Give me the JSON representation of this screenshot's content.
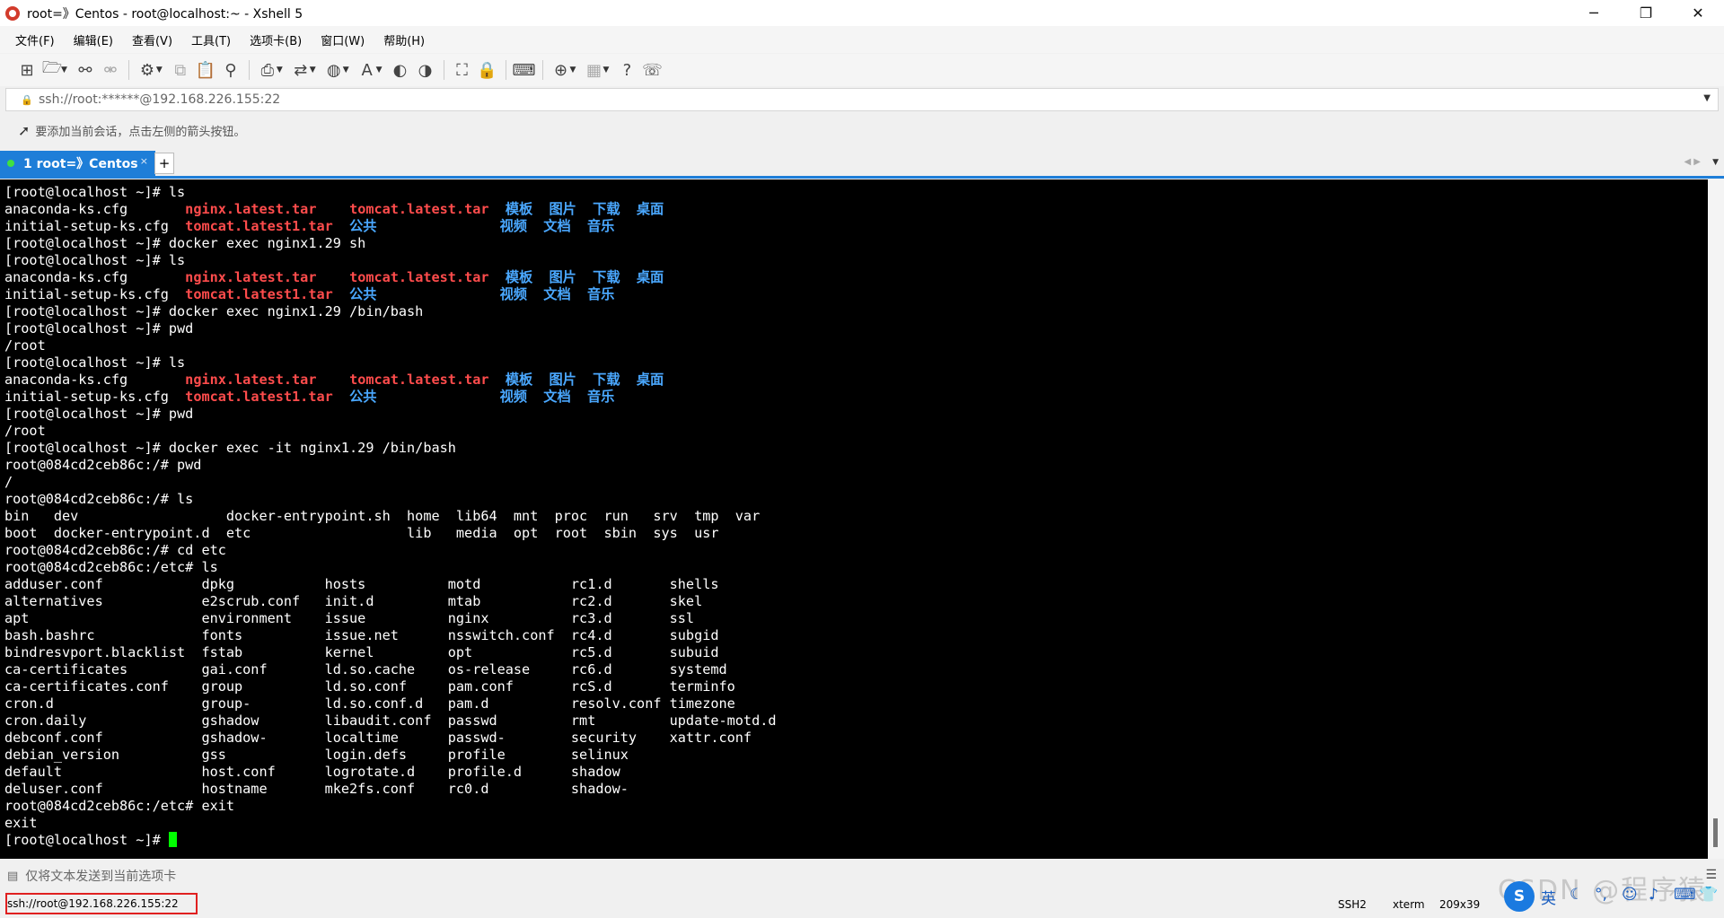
{
  "window": {
    "title": "root=》Centos - root@localhost:~ - Xshell 5",
    "minimize": "─",
    "restore": "❐",
    "close": "✕"
  },
  "menu": [
    "文件(F)",
    "编辑(E)",
    "查看(V)",
    "工具(T)",
    "选项卡(B)",
    "窗口(W)",
    "帮助(H)"
  ],
  "address": {
    "value": "ssh://root:******@192.168.226.155:22"
  },
  "hint": {
    "text": "要添加当前会话，点击左侧的箭头按钮。"
  },
  "tabs": [
    {
      "label": "1 root=》Centos",
      "close": "×"
    }
  ],
  "tab_add": "+",
  "terminal": {
    "prompt_final": "[root@localhost ~]# "
  },
  "sendbar": {
    "text": "仅将文本发送到当前选项卡"
  },
  "status": {
    "session": "ssh://root@192.168.226.155:22",
    "protocol": "SSH2",
    "term": "xterm",
    "size": "209x39"
  },
  "ime": {
    "logo": "S",
    "lang": "英"
  },
  "watermark": "CSDN @程序猿",
  "colors": {
    "accent": "#1e7ed8",
    "terminal_bg": "#000000",
    "archive_red": "#ff4c4c",
    "dir_blue": "#4aa8ff",
    "cursor_green": "#00ff00"
  }
}
